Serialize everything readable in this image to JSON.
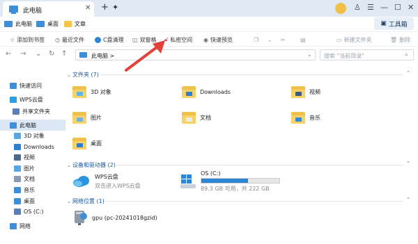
{
  "window": {
    "tab_title": "此电脑"
  },
  "bookmarks": [
    "此电脑",
    "桌面",
    "文章"
  ],
  "toolbox_label": "工具箱",
  "ribbon": {
    "add_bookmark": "添加到书签",
    "recent": "最近文件",
    "c_clean": "C盘清理",
    "dual_pane": "双窗格",
    "private": "私密空间",
    "quick_preview": "快速预览",
    "new_folder": "新建文件夹",
    "delete": "删除"
  },
  "address": {
    "path": "此电脑",
    "separator": ">"
  },
  "search": {
    "placeholder": "搜索 \"当前目录\""
  },
  "sidebar": {
    "items": [
      {
        "label": "快速访问",
        "icon": "star-icon",
        "color": "#3f8fd8"
      },
      {
        "label": "WPS云盘",
        "icon": "cloud-icon",
        "color": "#2aa0e0"
      },
      {
        "label": "共享文件夹",
        "icon": "people-icon",
        "color": "#5a7fb8"
      },
      {
        "label": "此电脑",
        "icon": "computer-icon",
        "color": "#3f8fd8"
      },
      {
        "label": "3D 对象",
        "icon": "cube-icon",
        "color": "#5aa7e0"
      },
      {
        "label": "Downloads",
        "icon": "download-icon",
        "color": "#2f7fd0"
      },
      {
        "label": "视频",
        "icon": "video-icon",
        "color": "#4a6b8a"
      },
      {
        "label": "图片",
        "icon": "picture-icon",
        "color": "#5aa7e0"
      },
      {
        "label": "文档",
        "icon": "document-icon",
        "color": "#8a9bb0"
      },
      {
        "label": "音乐",
        "icon": "music-icon",
        "color": "#3f8fd8"
      },
      {
        "label": "桌面",
        "icon": "desktop-icon",
        "color": "#3f8fd8"
      },
      {
        "label": "OS (C:)",
        "icon": "drive-icon",
        "color": "#5a7fb8"
      },
      {
        "label": "网络",
        "icon": "network-icon",
        "color": "#3f8fd8"
      }
    ]
  },
  "groups": {
    "folders": "文件夹 (7)",
    "devices": "设备和驱动器 (2)",
    "network": "网络位置 (1)"
  },
  "folders": [
    {
      "name": "3D 对象",
      "icon": "3d-objects-folder-icon",
      "mark": "#5bb8ea"
    },
    {
      "name": "Downloads",
      "icon": "downloads-folder-icon",
      "mark": "#2f7fd0"
    },
    {
      "name": "视频",
      "icon": "video-folder-icon",
      "mark": "#3b5b7d"
    },
    {
      "name": "图片",
      "icon": "pictures-folder-icon",
      "mark": "#6fb3e3"
    },
    {
      "name": "文档",
      "icon": "documents-folder-icon",
      "mark": "#e8ecf1"
    },
    {
      "name": "音乐",
      "icon": "music-folder-icon",
      "mark": "#2f8ad8"
    },
    {
      "name": "桌面",
      "icon": "desktop-folder-icon",
      "mark": "#2f7fd0"
    }
  ],
  "devices": {
    "wps": {
      "name": "WPS云盘",
      "sub": "双击进入WPS云盘"
    },
    "os": {
      "name": "OS (C:)",
      "usage": "89.3 GB 可用，共 222 GB",
      "used_fraction": 0.6
    }
  },
  "network_item": {
    "name": "gpu (pc-20241018gzid)"
  },
  "colors": {
    "accent": "#1a5aa0",
    "arrow": "#e2413a",
    "drive_bar": "#2b86d6"
  }
}
